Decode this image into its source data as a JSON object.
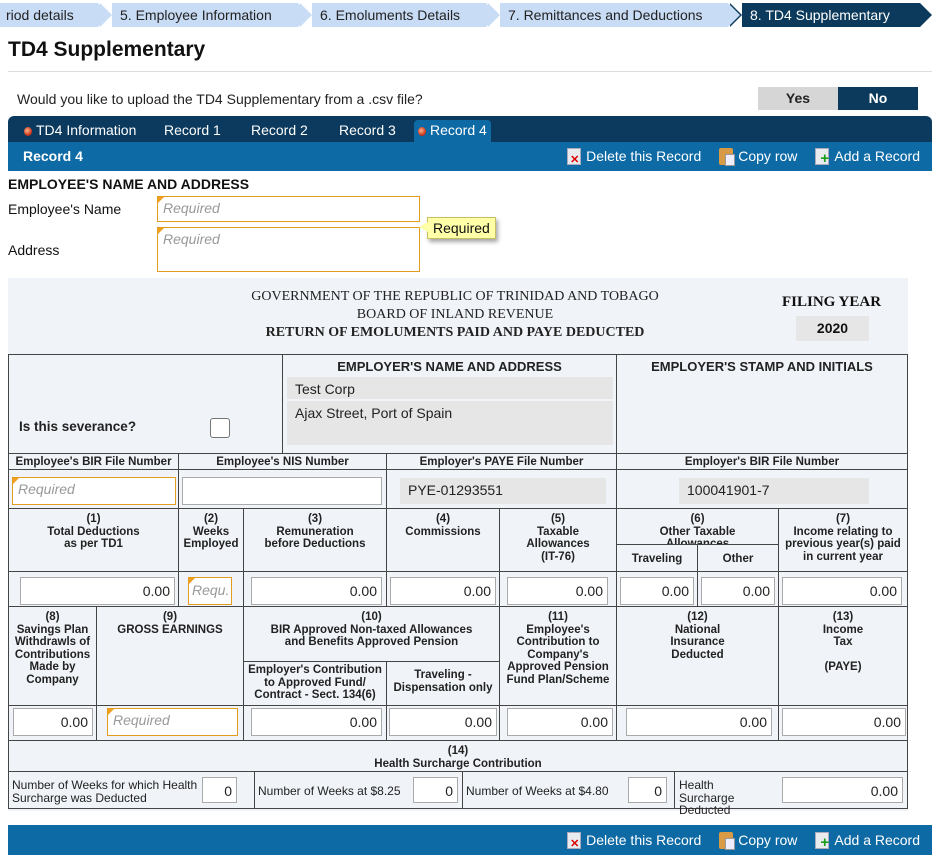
{
  "wizard": {
    "steps": [
      "riod details",
      "5. Employee Information",
      "6. Emoluments Details",
      "7. Remittances and Deductions",
      "8. TD4 Supplementary"
    ],
    "active_index": 4
  },
  "page_title": "TD4 Supplementary",
  "csv_question": "Would you like to upload the TD4 Supplementary from a .csv file?",
  "csv_toggle": {
    "yes": "Yes",
    "no": "No",
    "selected": "No"
  },
  "tabs": [
    {
      "label": "TD4 Information",
      "warning": true
    },
    {
      "label": "Record 1",
      "warning": false
    },
    {
      "label": "Record 2",
      "warning": false
    },
    {
      "label": "Record 3",
      "warning": false
    },
    {
      "label": "Record 4",
      "warning": true,
      "active": true
    }
  ],
  "record_bar": {
    "title": "Record 4",
    "delete_label": "Delete this Record",
    "copy_label": "Copy row",
    "add_label": "Add a Record"
  },
  "employee": {
    "section_title": "EMPLOYEE'S NAME AND ADDRESS",
    "name_label": "Employee's Name",
    "name_placeholder": "Required",
    "address_label": "Address",
    "address_placeholder": "Required",
    "tooltip": "Required"
  },
  "form_header": {
    "line1": "GOVERNMENT OF THE REPUBLIC OF TRINIDAD AND TOBAGO",
    "line2": "BOARD OF INLAND REVENUE",
    "line3": "RETURN OF EMOLUMENTS PAID AND PAYE DEDUCTED",
    "filing_year_label": "FILING YEAR",
    "filing_year": "2020"
  },
  "employer": {
    "severance_label": "Is this severance?",
    "severance_checked": false,
    "name_address_title": "EMPLOYER'S NAME AND ADDRESS",
    "name": "Test Corp",
    "address": "Ajax Street, Port of Spain",
    "stamp_title": "EMPLOYER'S STAMP AND INITIALS"
  },
  "ids": {
    "emp_bir_label": "Employee's BIR File Number",
    "emp_bir_placeholder": "Required",
    "emp_nis_label": "Employee's NIS Number",
    "emp_nis_value": "",
    "paye_label": "Employer's PAYE File Number",
    "paye_value": "PYE-01293551",
    "employer_bir_label": "Employer's BIR File Number",
    "employer_bir_value": "100041901-7"
  },
  "row1": {
    "c1": {
      "num": "(1)",
      "label": "Total Deductions as per TD1",
      "value": "0.00"
    },
    "c2": {
      "num": "(2)",
      "label": "Weeks Employed",
      "placeholder": "Requ."
    },
    "c3": {
      "num": "(3)",
      "label": "Remuneration before Deductions",
      "value": "0.00"
    },
    "c4": {
      "num": "(4)",
      "label": "Commissions",
      "value": "0.00"
    },
    "c5": {
      "num": "(5)",
      "label": "Taxable Allowances (IT-76)",
      "value": "0.00"
    },
    "c6": {
      "num": "(6)",
      "label": "Other Taxable Allowances",
      "sub1": "Traveling",
      "sub1_value": "0.00",
      "sub2": "Other",
      "sub2_value": "0.00"
    },
    "c7": {
      "num": "(7)",
      "label": "Income relating to previous year(s) paid in current year",
      "value": "0.00"
    }
  },
  "row2": {
    "c8": {
      "num": "(8)",
      "label": "Savings Plan Withdrawls of Contributions Made by Company",
      "value": "0.00"
    },
    "c9": {
      "num": "(9)",
      "label": "GROSS EARNINGS",
      "placeholder": "Required"
    },
    "c10": {
      "num": "(10)",
      "label": "BIR Approved Non-taxed Allowances and Benefits Approved Pension",
      "sub1": "Employer's Contribution to Approved Fund/ Contract - Sect. 134(6)",
      "sub1_value": "0.00",
      "sub2": "Traveling - Dispensation only",
      "sub2_value": "0.00"
    },
    "c11": {
      "num": "(11)",
      "label": "Employee's Contribution to Company's Approved Pension Fund Plan/Scheme",
      "value": "0.00"
    },
    "c12": {
      "num": "(12)",
      "label": "National Insurance Deducted",
      "value": "0.00"
    },
    "c13": {
      "num": "(13)",
      "label": "Income Tax",
      "label2": "(PAYE)",
      "value": "0.00"
    }
  },
  "health": {
    "num": "(14)",
    "title": "Health Surcharge Contribution",
    "weeks_deducted_label": "Number of Weeks for which Health Surcharge was Deducted",
    "weeks_deducted": "0",
    "weeks_825_label": "Number of Weeks at $8.25",
    "weeks_825": "0",
    "weeks_480_label": "Number of Weeks at $4.80",
    "weeks_480": "0",
    "deducted_label": "Health Surcharge Deducted",
    "deducted": "0.00"
  },
  "colors": {
    "nav_dark": "#0b3a5e",
    "nav_blue": "#0d6aa5",
    "step_bg": "#c9dcf5",
    "required_border": "#e39c1d",
    "tooltip_bg": "#ffffa8"
  }
}
